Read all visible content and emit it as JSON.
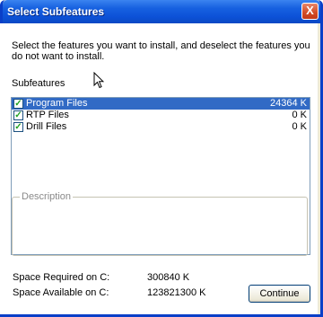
{
  "window": {
    "title": "Select Subfeatures",
    "close_label": "X"
  },
  "instructions": "Select the features you want to install, and deselect the features you do not want to install.",
  "subfeatures": {
    "label": "Subfeatures",
    "items": [
      {
        "label": "Program Files",
        "size": "24364 K",
        "checked": true,
        "selected": true
      },
      {
        "label": "RTP Files",
        "size": "0 K",
        "checked": true,
        "selected": false
      },
      {
        "label": "Drill Files",
        "size": "0 K",
        "checked": true,
        "selected": false
      }
    ]
  },
  "description": {
    "label": "Description"
  },
  "space": {
    "required_label": "Space Required on C:",
    "required_value": "300840 K",
    "available_label": "Space Available on C:",
    "available_value": "123821300 K"
  },
  "buttons": {
    "continue": "Continue"
  }
}
